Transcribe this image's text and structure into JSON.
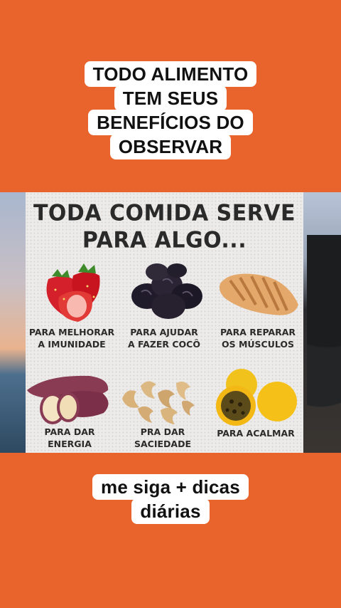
{
  "top_caption": {
    "lines": [
      "TODO ALIMENTO",
      "TEM SEUS",
      "BENEFÍCIOS DO",
      "OBSERVAR"
    ]
  },
  "poster": {
    "title_lines": [
      "TODA COMIDA SERVE",
      "PARA ALGO..."
    ],
    "items": [
      {
        "food": "strawberry-icon",
        "label_lines": [
          "PARA MELHORAR",
          "A IMUNIDADE"
        ]
      },
      {
        "food": "prunes-icon",
        "label_lines": [
          "PARA AJUDAR",
          "A FAZER COCÔ"
        ]
      },
      {
        "food": "chicken-breast-icon",
        "label_lines": [
          "PARA REPARAR",
          "OS MÚSCULOS"
        ]
      },
      {
        "food": "sweet-potato-icon",
        "label_lines": [
          "PARA DAR",
          "ENERGIA"
        ]
      },
      {
        "food": "cashew-icon",
        "label_lines": [
          "PRA DAR",
          "SACIEDADE"
        ]
      },
      {
        "food": "passion-fruit-icon",
        "label_lines": [
          "PARA ACALMAR"
        ]
      }
    ]
  },
  "bottom_caption": {
    "lines": [
      "me siga + dicas",
      "diárias"
    ]
  },
  "colors": {
    "background": "#e8642c",
    "caption_bg": "#ffffff"
  }
}
